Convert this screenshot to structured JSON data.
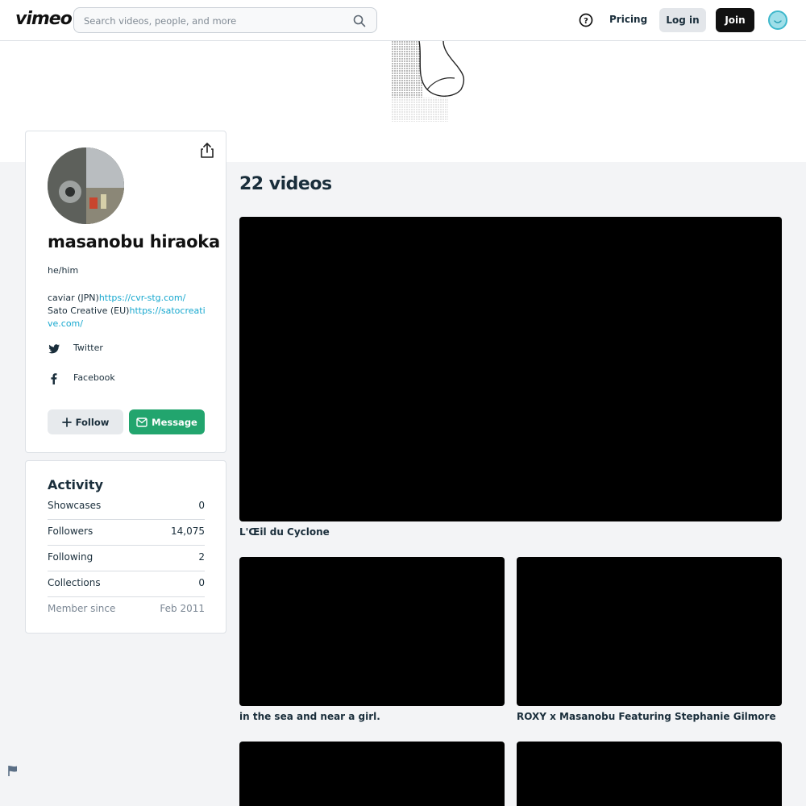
{
  "header": {
    "logo": "vimeo",
    "search_placeholder": "Search videos, people, and more",
    "pricing_label": "Pricing",
    "login_label": "Log in",
    "join_label": "Join"
  },
  "profile": {
    "name": "masanobu hiraoka",
    "pronouns": "he/him",
    "bio_line1_text": "caviar (JPN)",
    "bio_line1_link": "https://cvr-stg.com/",
    "bio_line2_text": "Sato Creative (EU)",
    "bio_line2_link": "https://satocreative.com/",
    "social": [
      {
        "icon": "twitter-icon",
        "label": "Twitter"
      },
      {
        "icon": "facebook-icon",
        "label": "Facebook"
      }
    ],
    "follow_label": "Follow",
    "message_label": "Message"
  },
  "activity": {
    "title": "Activity",
    "stats": [
      {
        "label": "Showcases",
        "value": "0"
      },
      {
        "label": "Followers",
        "value": "14,075"
      },
      {
        "label": "Following",
        "value": "2"
      },
      {
        "label": "Collections",
        "value": "0"
      },
      {
        "label": "Member since",
        "value": "Feb 2011"
      }
    ]
  },
  "videos": {
    "count_label": "22 videos",
    "items": [
      {
        "title": "L'Œil du Cyclone"
      },
      {
        "title": "in the sea and near a girl."
      },
      {
        "title": "ROXY x Masanobu Featuring Stephanie Gilmore"
      },
      {
        "title": ""
      },
      {
        "title": ""
      }
    ]
  },
  "colors": {
    "accent_link": "#17a8cf",
    "message_button": "#22a56e",
    "join_button": "#111111"
  }
}
